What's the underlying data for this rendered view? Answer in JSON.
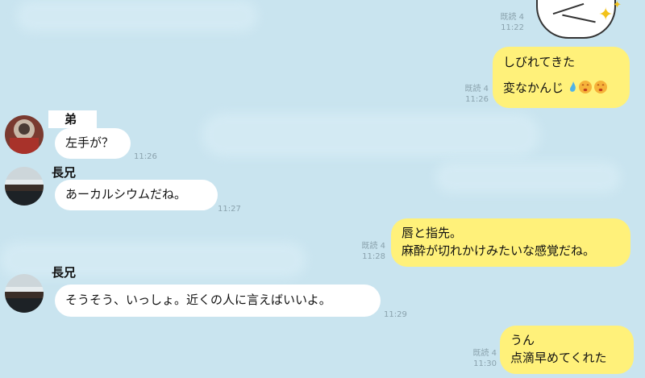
{
  "chat": {
    "messages": [
      {
        "side": "out",
        "lines": [],
        "read": "既読 4",
        "time": "11:22",
        "is_sticker": true
      },
      {
        "side": "out",
        "lines": [
          "しびれてきた",
          "",
          "変なかんじ"
        ],
        "read": "既読 4",
        "time": "11:26",
        "emoji": [
          "sweat-drop-icon",
          "dizzy-face-icon",
          "dizzy-face-icon"
        ]
      },
      {
        "side": "in",
        "sender": "弟",
        "lines": [
          "左手が？"
        ],
        "time": "11:26"
      },
      {
        "side": "in",
        "sender": "長兄",
        "lines": [
          "あーカルシウムだね。"
        ],
        "time": "11:27"
      },
      {
        "side": "out",
        "lines": [
          "唇と指先。",
          "麻酔が切れかけみたいな感覚だね。"
        ],
        "read": "既読 4",
        "time": "11:28"
      },
      {
        "side": "in",
        "sender": "長兄",
        "lines": [
          "そうそう、いっしょ。近くの人に言えばいいよ。"
        ],
        "time": "11:29"
      },
      {
        "side": "out",
        "lines": [
          "うん",
          "点滴早めてくれた"
        ],
        "read": "既読 4",
        "time": "11:30"
      }
    ]
  },
  "colors": {
    "background": "#c9e4ef",
    "outgoing_bubble": "#fff17a",
    "incoming_bubble": "#ffffff",
    "meta_text": "#8aa2ad"
  }
}
